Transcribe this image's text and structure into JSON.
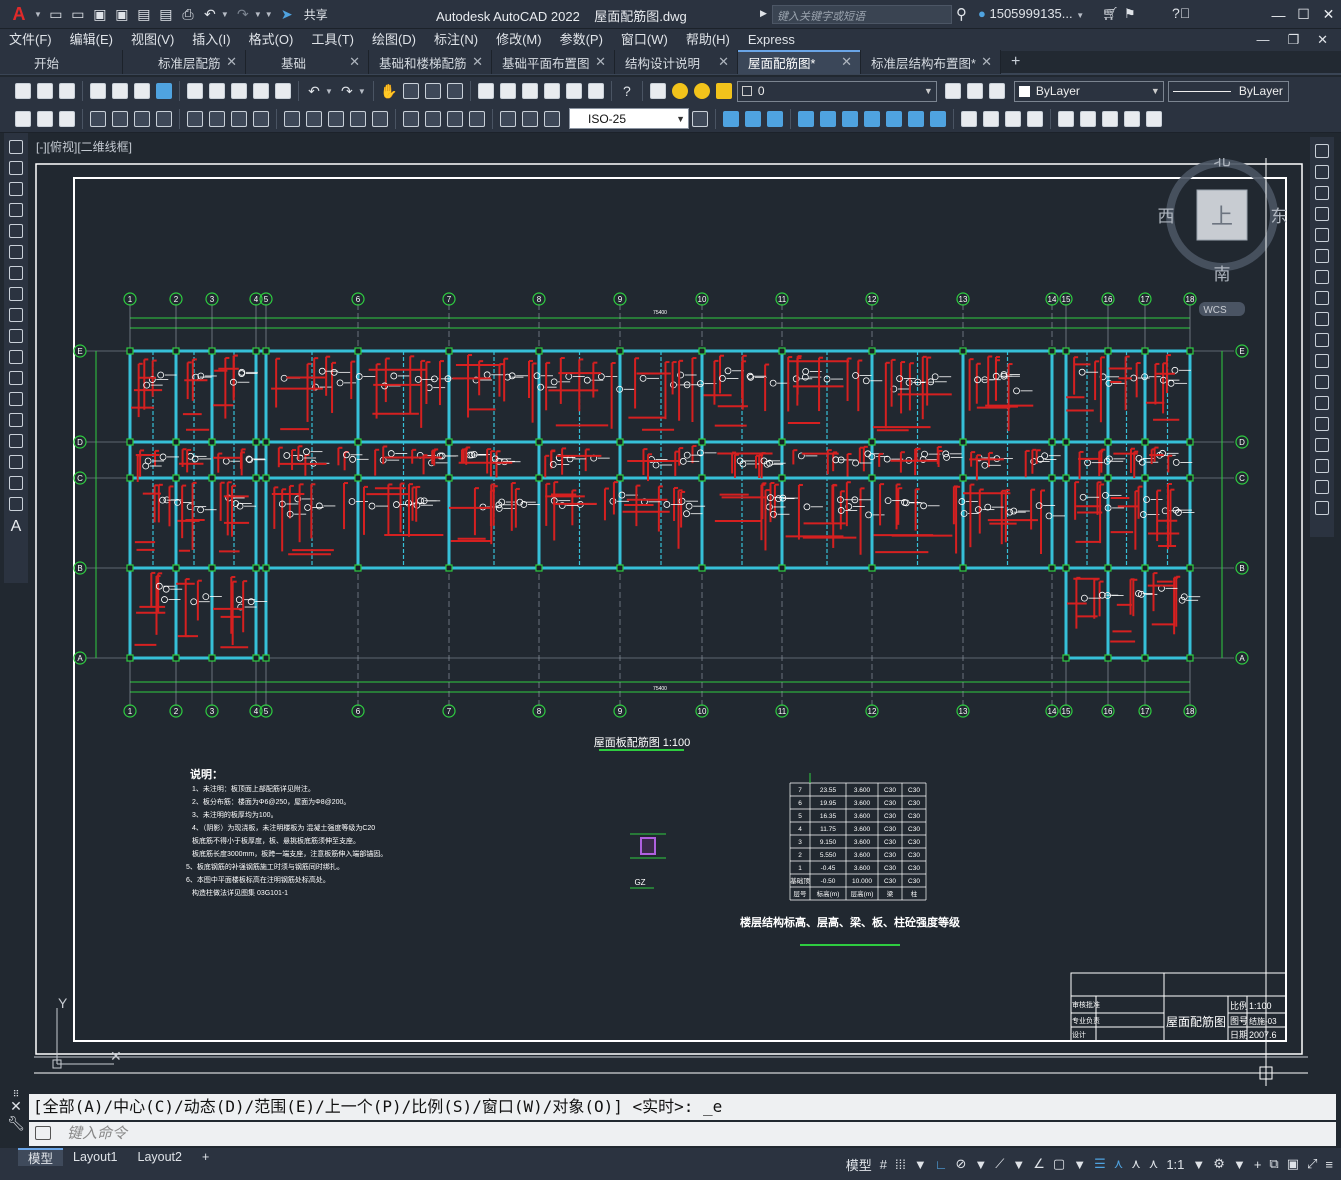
{
  "app": {
    "title": "Autodesk AutoCAD 2022",
    "file": "屋面配筋图.dwg",
    "share_label": "共享",
    "search_placeholder": "键入关键字或短语",
    "user": "1505999135...",
    "logo": "A"
  },
  "menu": [
    "文件(F)",
    "编辑(E)",
    "视图(V)",
    "插入(I)",
    "格式(O)",
    "工具(T)",
    "绘图(D)",
    "标注(N)",
    "修改(M)",
    "参数(P)",
    "窗口(W)",
    "帮助(H)",
    "Express"
  ],
  "tabs": [
    {
      "label": "开始"
    },
    {
      "label": "标准层配筋"
    },
    {
      "label": "基础"
    },
    {
      "label": "基础和楼梯配筋"
    },
    {
      "label": "基础平面布置图"
    },
    {
      "label": "结构设计说明"
    },
    {
      "label": "屋面配筋图*",
      "active": true
    },
    {
      "label": "标准层结构布置图*"
    }
  ],
  "toolbar": {
    "layer": "0",
    "color": "ByLayer",
    "linetype": "ByLayer",
    "dimstyle": "ISO-25"
  },
  "viewport": {
    "label": "[-][俯视][二维线框]",
    "viewcube": {
      "top": "上",
      "north": "北",
      "south": "南",
      "east": "东",
      "west": "西",
      "wcs": "WCS"
    }
  },
  "drawing": {
    "plan_title": "屋面板配筋图 1:100",
    "grid_top": [
      "1",
      "2",
      "3",
      "4",
      "5",
      "6",
      "7",
      "8",
      "9",
      "10",
      "11",
      "12",
      "13",
      "14",
      "15",
      "16",
      "17",
      "18"
    ],
    "grid_side": [
      "E",
      "D",
      "C",
      "B",
      "A"
    ],
    "overall_dim": "75400",
    "notes_title": "说明：",
    "notes": [
      "1、未注明：板顶面上部配筋详见附注。",
      "2、板分布筋：楼面为Φ6@250，屋面为Φ8@200。",
      "3、未注明的板厚均为100。",
      "4、（阴影）为现浇板，未注明楼板为    混凝土强度等级为C20",
      "   板底筋不得小于板厚度，板、悬挑板底筋须伸至支座。",
      "   板底筋长度3000mm，板跨一端支座，注意板筋伸入端部锚固。",
      "5、板底钢筋的补强钢筋施工时须与钢筋同时绑扎。",
      "6、本图中平面楼板标高在注明钢筋处标高处。",
      "   构造柱做法详见图集  03G101-1"
    ],
    "table": {
      "rows": [
        [
          "7",
          "23.55",
          "3.600",
          "C30",
          "C30"
        ],
        [
          "6",
          "19.95",
          "3.600",
          "C30",
          "C30"
        ],
        [
          "5",
          "16.35",
          "3.600",
          "C30",
          "C30"
        ],
        [
          "4",
          "11.75",
          "3.600",
          "C30",
          "C30"
        ],
        [
          "3",
          "9.150",
          "3.600",
          "C30",
          "C30"
        ],
        [
          "2",
          "5.550",
          "3.600",
          "C30",
          "C30"
        ],
        [
          "1",
          "-0.45",
          "3.600",
          "C30",
          "C30"
        ],
        [
          "基础顶",
          "-0.50",
          "10.000",
          "C30",
          "C30"
        ]
      ],
      "footer": [
        "层号",
        "标高(m)",
        "层高(m)",
        "梁",
        "柱"
      ]
    },
    "table_title": "楼层结构标高、层高、梁、板、柱砼强度等级",
    "detail_label": "GZ",
    "titleblock": {
      "drawing_name": "屋面配筋图",
      "scale_label": "比例",
      "scale": "1:100",
      "no_label": "图号",
      "no": "结施-03",
      "date_label": "日期",
      "date": "2007.6",
      "rows": [
        "审核批准",
        "专业负责",
        "设计"
      ]
    }
  },
  "command": {
    "history": "[全部(A)/中心(C)/动态(D)/范围(E)/上一个(P)/比例(S)/窗口(W)/对象(O)] <实时>: _e",
    "placeholder": "键入命令"
  },
  "status": {
    "tabs": [
      {
        "label": "模型",
        "active": true
      },
      {
        "label": "Layout1"
      },
      {
        "label": "Layout2"
      }
    ],
    "model_label": "模型",
    "scale": "1:1"
  },
  "colors": {
    "bg": "#212830",
    "ui": "#2b3340",
    "beam": "#36c0d8",
    "rebar": "#d62020",
    "grid": "#2ecc40",
    "text": "#ffffff"
  }
}
